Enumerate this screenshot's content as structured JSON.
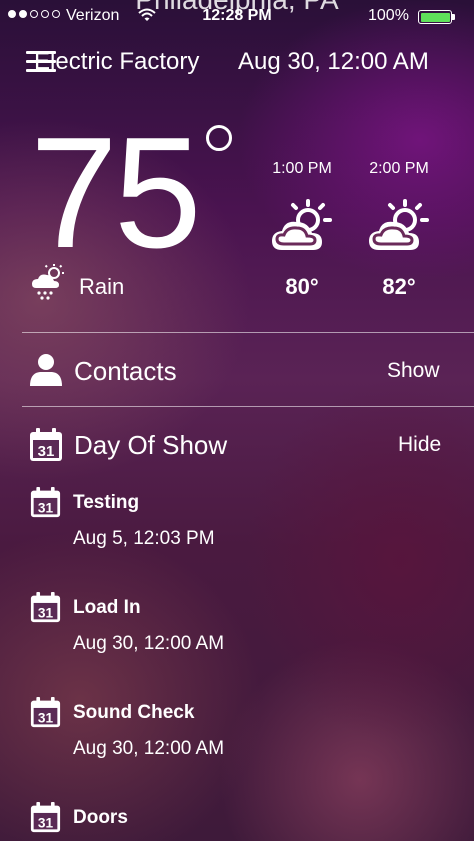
{
  "status_bar": {
    "carrier": "Verizon",
    "time": "12:28 PM",
    "battery_percent": "100%",
    "battery_level": 1.0,
    "signal_bars_filled": 2,
    "signal_bars_total": 5
  },
  "header": {
    "city": "Philadelphia, PA",
    "venue": "Electric Factory",
    "date": "Aug 30, 12:00 AM"
  },
  "weather": {
    "temperature": "75",
    "condition": "Rain",
    "condition_icon": "rain-cloud-icon",
    "forecast": [
      {
        "time": "1:00 PM",
        "temp": "80°",
        "icon": "partly-cloudy-icon"
      },
      {
        "time": "2:00 PM",
        "temp": "82°",
        "icon": "partly-cloudy-icon"
      }
    ]
  },
  "sections": {
    "contacts": {
      "label": "Contacts",
      "action": "Show",
      "icon": "person-icon"
    },
    "day_of_show": {
      "label": "Day Of Show",
      "action": "Hide",
      "icon": "calendar-icon"
    }
  },
  "calendar_icon_number": "31",
  "events": [
    {
      "title": "Testing",
      "date": "Aug 5, 12:03 PM"
    },
    {
      "title": "Load In",
      "date": "Aug 30, 12:00 AM"
    },
    {
      "title": "Sound Check",
      "date": "Aug 30, 12:00 AM"
    },
    {
      "title": "Doors",
      "date": ""
    }
  ],
  "colors": {
    "battery": "#5fe05a",
    "text": "#ffffff"
  }
}
